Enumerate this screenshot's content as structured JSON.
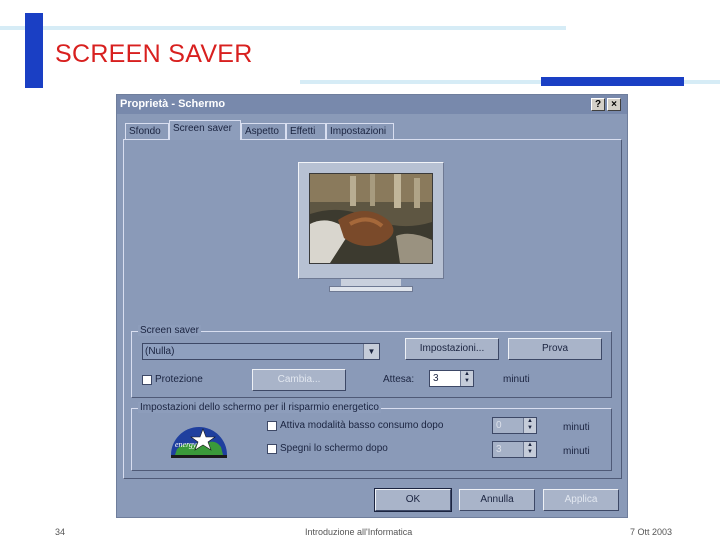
{
  "slide": {
    "title": "SCREEN SAVER",
    "footer_page": "34",
    "footer_center": "Introduzione all'Informatica",
    "footer_date": "7 Ott 2003"
  },
  "dialog": {
    "title": "Proprietà - Schermo",
    "help_label": "?",
    "close_label": "×",
    "tabs": [
      "Sfondo",
      "Screen saver",
      "Aspetto",
      "Effetti",
      "Impostazioni"
    ],
    "active_tab": "Screen saver",
    "screensaver_group": {
      "label": "Screen saver",
      "combo_value": "(Nulla)",
      "settings_button": "Impostazioni...",
      "preview_button": "Prova",
      "password_label": "Protezione",
      "change_button": "Cambia...",
      "wait_label": "Attesa:",
      "wait_value": "3",
      "wait_unit": "minuti"
    },
    "energy_group": {
      "label": "Impostazioni dello schermo per il risparmio energetico",
      "low_power_label": "Attiva modalità basso consumo dopo",
      "low_power_value": "0",
      "low_power_unit": "minuti",
      "shutoff_label": "Spegni lo schermo dopo",
      "shutoff_value": "3",
      "shutoff_unit": "minuti",
      "logo_text": "energy"
    },
    "buttons": {
      "ok": "OK",
      "cancel": "Annulla",
      "apply": "Applica"
    }
  },
  "colors": {
    "slide_title": "#d8201f",
    "accent_bar": "#1a3fc4",
    "dialog_bg": "#8a9ab8"
  }
}
